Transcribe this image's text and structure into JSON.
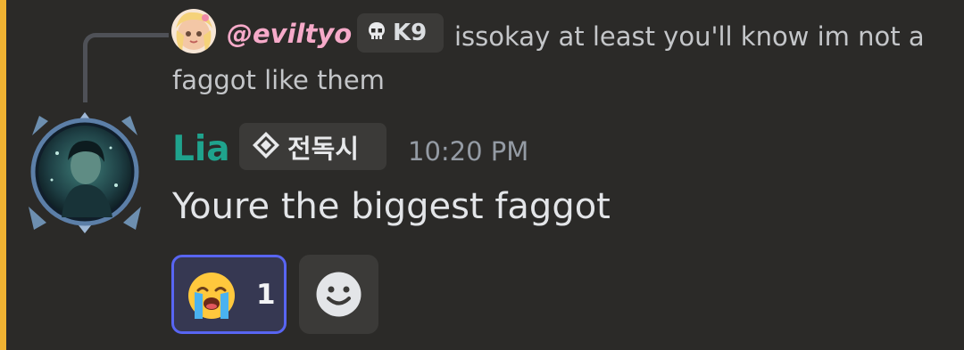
{
  "reply": {
    "username": "@eviltyo",
    "clan_tag": "K9",
    "text": "issokay at least you'll know im not a faggot like them"
  },
  "message": {
    "author": "Lia",
    "guild_tag": "전독시",
    "timestamp": "10:20 PM",
    "body": "Youre the biggest faggot"
  },
  "reactions": [
    {
      "emoji": "loudly-crying-face",
      "count": "1",
      "selected": true
    }
  ],
  "colors": {
    "accent_bar": "#f0b232",
    "author_name": "#1fa38d",
    "reply_username": "#f6aac9",
    "reaction_border": "#5865f2",
    "background": "#2b2a28"
  },
  "icons": {
    "clan_tag_icon": "skull-icon",
    "guild_tag_icon": "diamond-sparkle-icon",
    "add_reaction_icon": "smiley-face-icon"
  }
}
